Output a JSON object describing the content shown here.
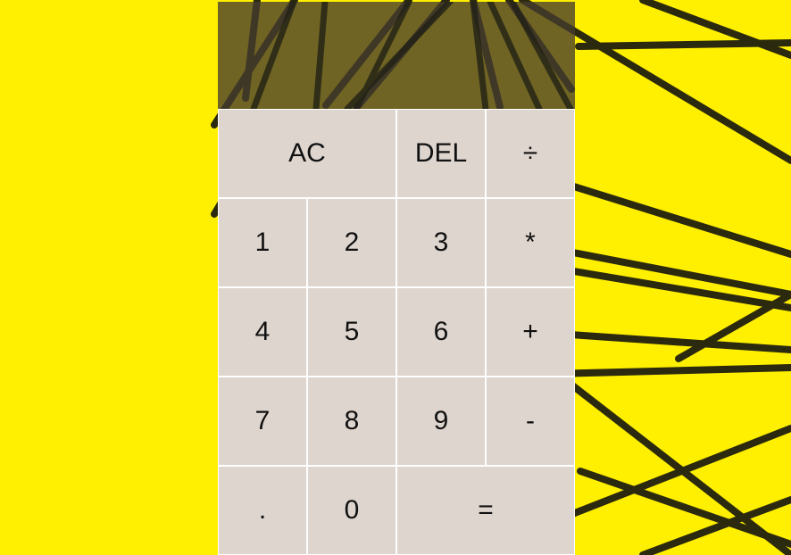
{
  "display": {
    "value": ""
  },
  "keys": {
    "clear": "AC",
    "delete": "DEL",
    "divide": "÷",
    "one": "1",
    "two": "2",
    "three": "3",
    "multiply": "*",
    "four": "4",
    "five": "5",
    "six": "6",
    "add": "+",
    "seven": "7",
    "eight": "8",
    "nine": "9",
    "subtract": "-",
    "decimal": ".",
    "zero": "0",
    "equals": "="
  },
  "colors": {
    "background": "#ffef00",
    "display": "#5f5232",
    "key": "#ded5cf",
    "text": "#111111"
  }
}
